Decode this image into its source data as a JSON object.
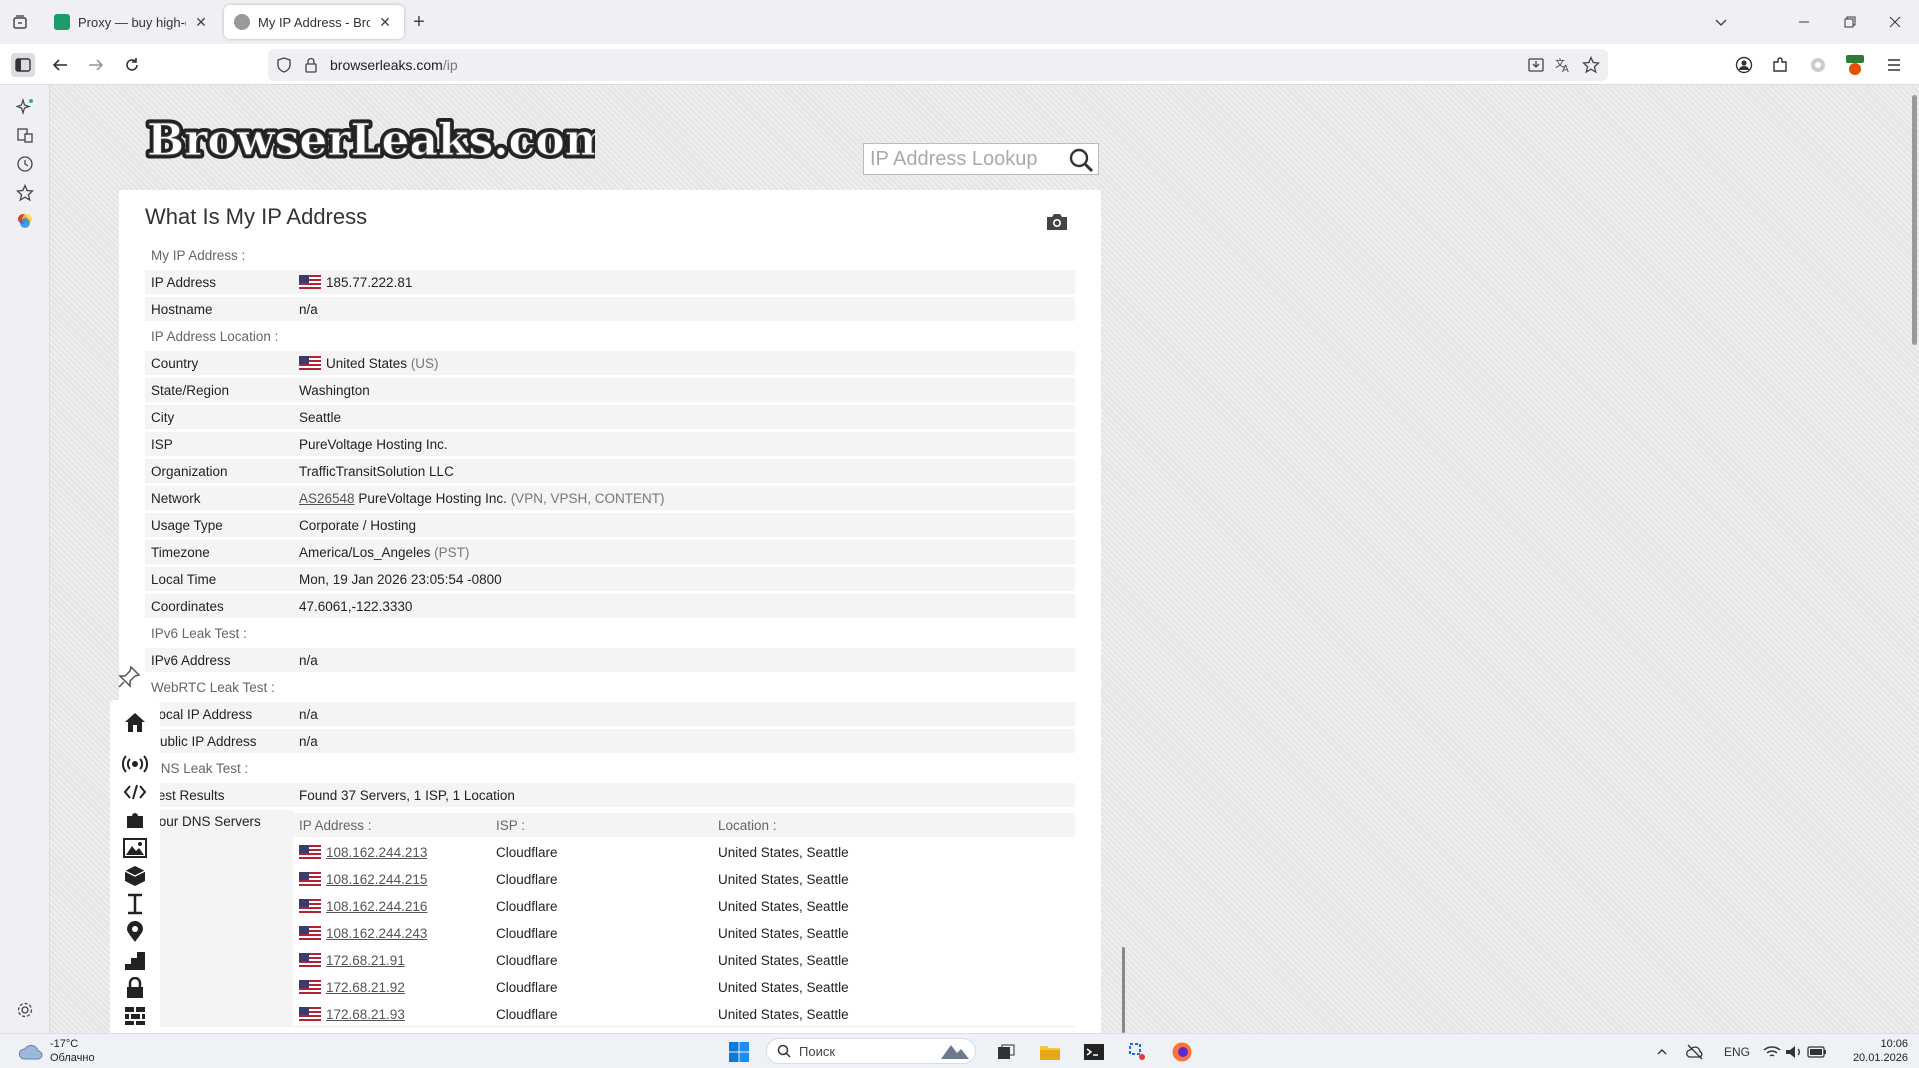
{
  "browser": {
    "tabs": [
      {
        "title": "Proxy — buy high-quality, reliab",
        "active": false
      },
      {
        "title": "My IP Address - BrowserLeaks",
        "active": true
      }
    ],
    "url_host": "browserleaks.com",
    "url_path": "/ip",
    "close_glyph": "✕",
    "new_tab_glyph": "+"
  },
  "site": {
    "logo_text": "BrowserLeaks.com",
    "search_placeholder": "IP Address Lookup",
    "page_title": "What Is My IP Address"
  },
  "ip": {
    "section": "My IP Address :",
    "address_label": "IP Address",
    "address": "185.77.222.81",
    "hostname_label": "Hostname",
    "hostname": "n/a"
  },
  "location": {
    "section": "IP Address Location :",
    "rows": [
      {
        "label": "Country",
        "value": "United States",
        "extra": "(US)",
        "flag": true
      },
      {
        "label": "State/Region",
        "value": "Washington"
      },
      {
        "label": "City",
        "value": "Seattle"
      },
      {
        "label": "ISP",
        "value": "PureVoltage Hosting Inc."
      },
      {
        "label": "Organization",
        "value": "TrafficTransitSolution LLC"
      },
      {
        "label": "Network",
        "link": "AS26548",
        "value": "PureVoltage Hosting Inc.",
        "extra": "(VPN, VPSH, CONTENT)"
      },
      {
        "label": "Usage Type",
        "value": "Corporate / Hosting"
      },
      {
        "label": "Timezone",
        "value": "America/Los_Angeles",
        "extra": "(PST)"
      },
      {
        "label": "Local Time",
        "value": "Mon, 19 Jan 2026 23:05:54 -0800"
      },
      {
        "label": "Coordinates",
        "value": "47.6061,-122.3330"
      }
    ]
  },
  "ipv6": {
    "section": "IPv6 Leak Test :",
    "label": "IPv6 Address",
    "value": "n/a"
  },
  "webrtc": {
    "section": "WebRTC Leak Test :",
    "local_label": "Local IP Address",
    "local_value": "n/a",
    "public_label": "Public IP Address",
    "public_value": "n/a"
  },
  "dns": {
    "section": "DNS Leak Test :",
    "results_label": "Test Results",
    "results_value": "Found 37 Servers, 1 ISP, 1 Location",
    "servers_label": "Your DNS Servers",
    "col_ip": "IP Address :",
    "col_isp": "ISP :",
    "col_location": "Location :",
    "servers": [
      {
        "ip": "108.162.244.213",
        "isp": "Cloudflare",
        "location": "United States, Seattle"
      },
      {
        "ip": "108.162.244.215",
        "isp": "Cloudflare",
        "location": "United States, Seattle"
      },
      {
        "ip": "108.162.244.216",
        "isp": "Cloudflare",
        "location": "United States, Seattle"
      },
      {
        "ip": "108.162.244.243",
        "isp": "Cloudflare",
        "location": "United States, Seattle"
      },
      {
        "ip": "172.68.21.91",
        "isp": "Cloudflare",
        "location": "United States, Seattle"
      },
      {
        "ip": "172.68.21.92",
        "isp": "Cloudflare",
        "location": "United States, Seattle"
      },
      {
        "ip": "172.68.21.93",
        "isp": "Cloudflare",
        "location": "United States, Seattle"
      }
    ]
  },
  "taskbar": {
    "temperature": "-17°C",
    "weather": "Облачно",
    "search_label": "Поиск",
    "language": "ENG",
    "time": "10:06",
    "date": "20.01.2026"
  },
  "icons": [
    "tab-list-icon",
    "back-arrow-icon",
    "forward-arrow-icon",
    "reload-icon",
    "shield-icon",
    "lock-icon",
    "download-icon",
    "translate-icon",
    "star-icon",
    "account-icon",
    "extensions-icon",
    "menu-icon",
    "camera-icon",
    "search-icon",
    "home-icon",
    "broadcast-icon",
    "code-icon",
    "puzzle-icon",
    "image-icon",
    "cube-icon",
    "text-cursor-icon",
    "map-pin-icon",
    "stairs-icon",
    "padlock-icon",
    "wall-icon",
    "more-icon",
    "tools-icon",
    "pin-icon"
  ],
  "colors": {
    "tab_bar": "#f0f0f4",
    "page_bg": "#e6e6e6",
    "row_bg": "#f4f4f4",
    "us_flag_red": "#b22234",
    "us_flag_blue": "#3c3b6e"
  }
}
